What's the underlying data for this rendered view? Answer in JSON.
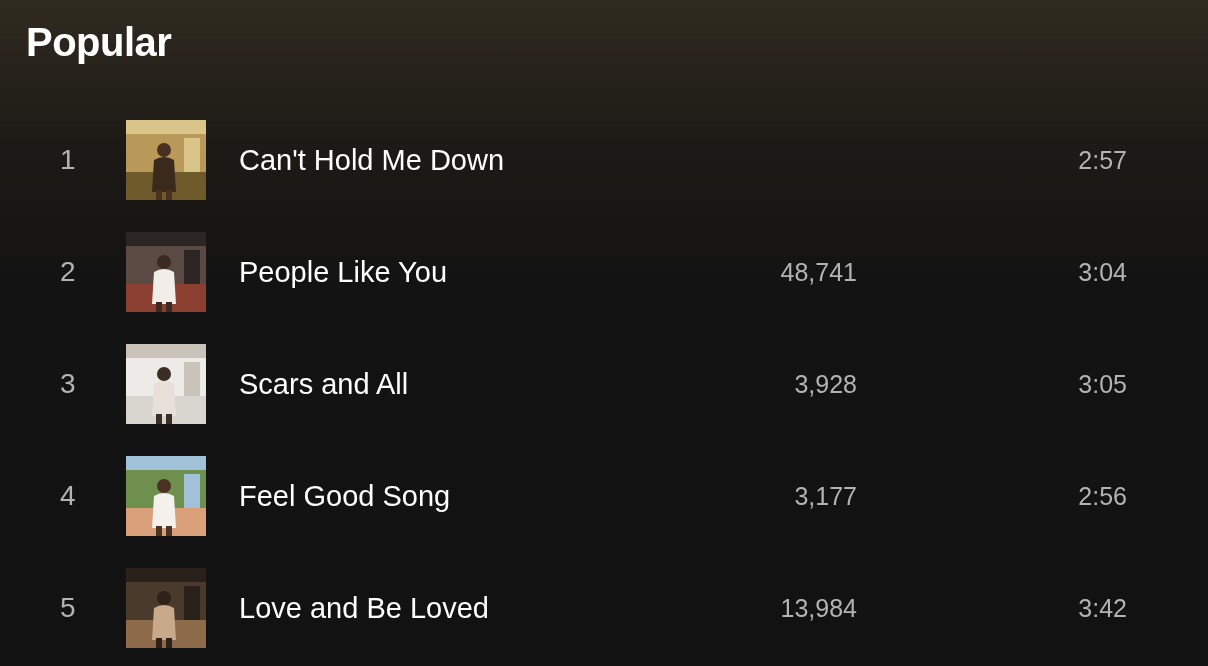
{
  "title": "Popular",
  "tracks": [
    {
      "number": "1",
      "title": "Can't Hold Me Down",
      "duration": "2:57"
    },
    {
      "number": "2",
      "title": "People Like You",
      "plays": "48,741",
      "duration": "3:04"
    },
    {
      "number": "3",
      "title": "Scars and All",
      "plays": "3,928",
      "duration": "3:05"
    },
    {
      "number": "4",
      "title": "Feel Good Song",
      "plays": "3,177",
      "duration": "2:56"
    },
    {
      "number": "5",
      "title": "Love and Be Loved",
      "plays": "13,984",
      "duration": "3:42"
    }
  ]
}
